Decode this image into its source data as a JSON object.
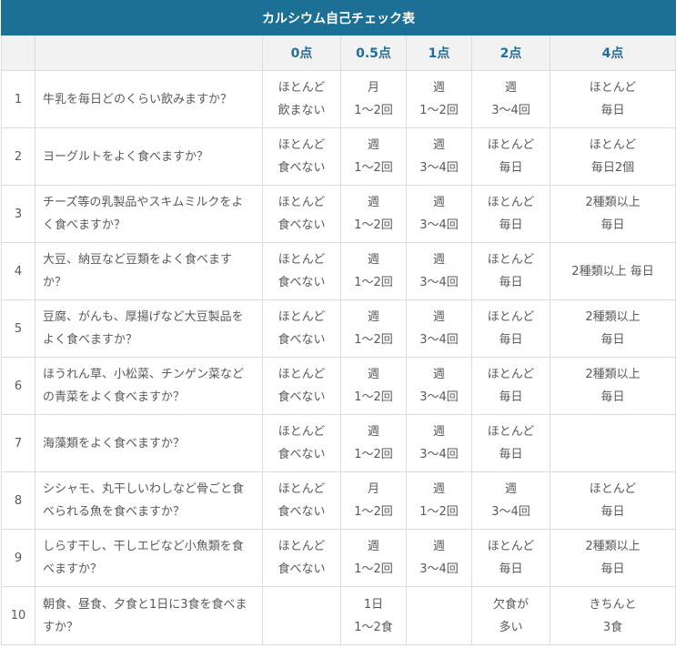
{
  "table": {
    "title": "カルシウム自己チェック表",
    "headers": [
      "",
      "",
      "0点",
      "0.5点",
      "1点",
      "2点",
      "4点"
    ],
    "rows": [
      {
        "num": "1",
        "question": "牛乳を毎日どのくらい飲みますか？",
        "scores": [
          [
            "ほとんど",
            "飲まない"
          ],
          [
            "月",
            "1～2回"
          ],
          [
            "週",
            "1～2回"
          ],
          [
            "週",
            "3～4回"
          ],
          [
            "ほとんど",
            "毎日"
          ]
        ]
      },
      {
        "num": "2",
        "question": "ヨーグルトをよく食べますか？",
        "scores": [
          [
            "ほとんど",
            "食べない"
          ],
          [
            "週",
            "1～2回"
          ],
          [
            "週",
            "3～4回"
          ],
          [
            "ほとんど",
            "毎日"
          ],
          [
            "ほとんど",
            "毎日2個"
          ]
        ]
      },
      {
        "num": "3",
        "question": "チーズ等の乳製品やスキムミルクをよく食べますか？",
        "scores": [
          [
            "ほとんど",
            "食べない"
          ],
          [
            "週",
            "1～2回"
          ],
          [
            "週",
            "3～4回"
          ],
          [
            "ほとんど",
            "毎日"
          ],
          [
            "2種類以上",
            "毎日"
          ]
        ]
      },
      {
        "num": "4",
        "question": "大豆、納豆など豆類をよく食べますか？",
        "scores": [
          [
            "ほとんど",
            "食べない"
          ],
          [
            "週",
            "1～2回"
          ],
          [
            "週",
            "3～4回"
          ],
          [
            "ほとんど",
            "毎日"
          ],
          [
            "2種類以上 毎日"
          ]
        ]
      },
      {
        "num": "5",
        "question": "豆腐、がんも、厚揚げなど大豆製品をよく食べますか？",
        "scores": [
          [
            "ほとんど",
            "食べない"
          ],
          [
            "週",
            "1～2回"
          ],
          [
            "週",
            "3～4回"
          ],
          [
            "ほとんど",
            "毎日"
          ],
          [
            "2種類以上",
            "毎日"
          ]
        ]
      },
      {
        "num": "6",
        "question": "ほうれん草、小松菜、チンゲン菜などの青菜をよく食べますか？",
        "scores": [
          [
            "ほとんど",
            "食べない"
          ],
          [
            "週",
            "1～2回"
          ],
          [
            "週",
            "3～4回"
          ],
          [
            "ほとんど",
            "毎日"
          ],
          [
            "2種類以上",
            "毎日"
          ]
        ]
      },
      {
        "num": "7",
        "question": "海藻類をよく食べますか？",
        "scores": [
          [
            "ほとんど",
            "食べない"
          ],
          [
            "週",
            "1～2回"
          ],
          [
            "週",
            "3～4回"
          ],
          [
            "ほとんど",
            "毎日"
          ],
          []
        ]
      },
      {
        "num": "8",
        "question": "シシャモ、丸干しいわしなど骨ごと食べられる魚を食べますか？",
        "scores": [
          [
            "ほとんど",
            "食べない"
          ],
          [
            "月",
            "1～2回"
          ],
          [
            "週",
            "1～2回"
          ],
          [
            "週",
            "3～4回"
          ],
          [
            "ほとんど",
            "毎日"
          ]
        ]
      },
      {
        "num": "9",
        "question": "しらす干し、干しエビなど小魚類を食べますか？",
        "scores": [
          [
            "ほとんど",
            "食べない"
          ],
          [
            "週",
            "1～2回"
          ],
          [
            "週",
            "3～4回"
          ],
          [
            "ほとんど",
            "毎日"
          ],
          [
            "2種類以上",
            "毎日"
          ]
        ]
      },
      {
        "num": "10",
        "question": "朝食、昼食、夕食と1日に3食を食べますか？",
        "scores": [
          [],
          [
            "1日",
            "1～2食"
          ],
          [],
          [
            "欠食が",
            "多い"
          ],
          [
            "きちんと",
            "3食"
          ]
        ]
      }
    ]
  }
}
